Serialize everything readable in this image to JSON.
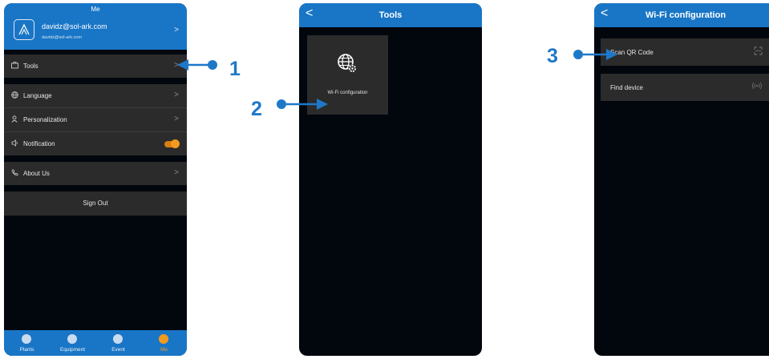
{
  "screen1": {
    "header_title": "Me",
    "profile": {
      "name": "davidz@sol-ark.com",
      "email": "davidz@sol-ark.com"
    },
    "menu": [
      {
        "label": "Tools",
        "icon": "toolbox-icon"
      },
      {
        "label": "Language",
        "icon": "globe-icon"
      },
      {
        "label": "Personalization",
        "icon": "person-icon"
      },
      {
        "label": "Notification",
        "icon": "speaker-icon",
        "toggle_on": true
      },
      {
        "label": "About Us",
        "icon": "phone-icon"
      }
    ],
    "sign_out": "Sign Out",
    "tabs": [
      {
        "label": "Plants",
        "active": false
      },
      {
        "label": "Equipment",
        "active": false
      },
      {
        "label": "Event",
        "active": false
      },
      {
        "label": "Me",
        "active": true
      }
    ]
  },
  "screen2": {
    "header_title": "Tools",
    "tile_label": "Wi-Fi configuration"
  },
  "screen3": {
    "header_title": "Wi-Fi configuration",
    "rows": [
      {
        "label": "Scan QR Code",
        "icon": "scan-icon"
      },
      {
        "label": "Find device",
        "icon": "wireless-signal-icon"
      }
    ]
  },
  "annotations": {
    "step1": "1",
    "step2": "2",
    "step3": "3"
  },
  "colors": {
    "primary": "#1976c6",
    "accent": "#f29a1f",
    "row_bg": "#2b2b2b",
    "screen_bg": "#02060d",
    "callout": "#1e78c8"
  }
}
